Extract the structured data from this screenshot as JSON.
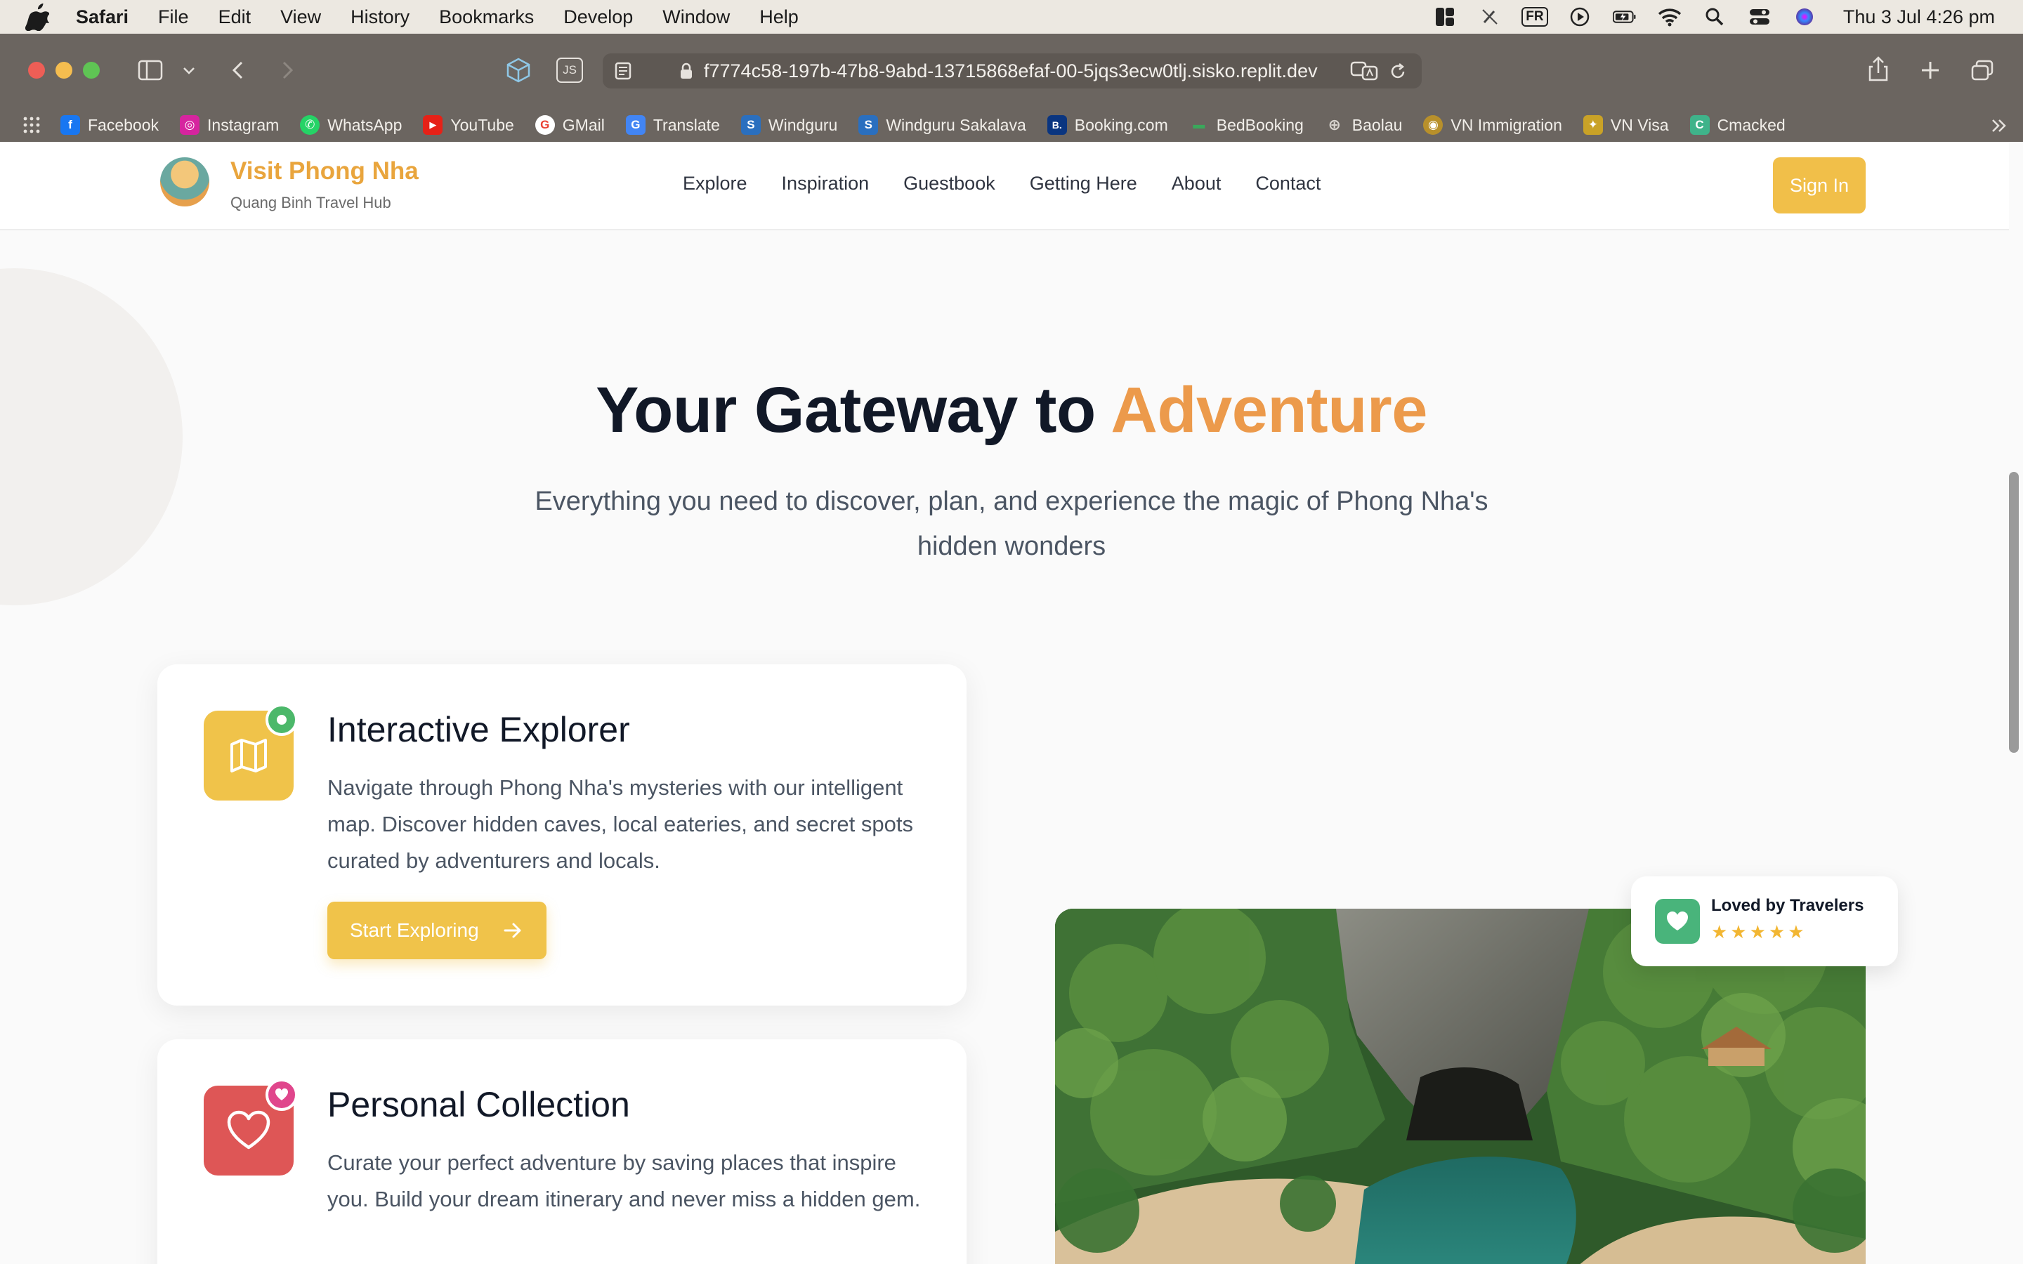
{
  "menubar": {
    "app": "Safari",
    "items": [
      "File",
      "Edit",
      "View",
      "History",
      "Bookmarks",
      "Develop",
      "Window",
      "Help"
    ],
    "input_lang": "FR",
    "clock": "Thu 3 Jul  4:26 pm"
  },
  "browser": {
    "url": "f7774c58-197b-47b8-9abd-13715868efaf-00-5jqs3ecw0tlj.sisko.replit.dev",
    "js_label": "JS",
    "bookmarks": [
      {
        "label": "Facebook",
        "color": "#1877f2",
        "glyph": "f"
      },
      {
        "label": "Instagram",
        "color": "#d6249f",
        "glyph": "◎"
      },
      {
        "label": "WhatsApp",
        "color": "#25d366",
        "glyph": "✆"
      },
      {
        "label": "YouTube",
        "color": "#e62117",
        "glyph": "▶"
      },
      {
        "label": "GMail",
        "color": "#ea4335",
        "glyph": "G"
      },
      {
        "label": "Translate",
        "color": "#4285f4",
        "glyph": "G"
      },
      {
        "label": "Windguru",
        "color": "#2a6fbf",
        "glyph": "S"
      },
      {
        "label": "Windguru Sakalava",
        "color": "#2a6fbf",
        "glyph": "S"
      },
      {
        "label": "Booking.com",
        "color": "#0a3580",
        "glyph": "B."
      },
      {
        "label": "BedBooking",
        "color": "#3aa85b",
        "glyph": "▬"
      },
      {
        "label": "Baolau",
        "color": "#777777",
        "glyph": "⊕"
      },
      {
        "label": "VN Immigration",
        "color": "#b8902b",
        "glyph": "◉"
      },
      {
        "label": "VN Visa",
        "color": "#c9a227",
        "glyph": "✦"
      },
      {
        "label": "Cmacked",
        "color": "#3fb38a",
        "glyph": "C"
      }
    ]
  },
  "site": {
    "brand": "Visit Phong Nha",
    "tagline": "Quang Binh Travel Hub",
    "nav": [
      "Explore",
      "Inspiration",
      "Guestbook",
      "Getting Here",
      "About",
      "Contact"
    ],
    "sign_in": "Sign In"
  },
  "hero": {
    "title_main": "Your Gateway to ",
    "title_accent": "Adventure",
    "subtitle": "Everything you need to discover, plan, and experience the magic of Phong Nha's hidden wonders"
  },
  "cards": [
    {
      "title": "Interactive Explorer",
      "text": "Navigate through Phong Nha's mysteries with our intelligent map. Discover hidden caves, local eateries, and secret spots curated by adventurers and locals.",
      "cta": "Start Exploring",
      "icon": "map-icon"
    },
    {
      "title": "Personal Collection",
      "text": "Curate your perfect adventure by saving places that inspire you. Build your dream itinerary and never miss a hidden gem.",
      "icon": "heart-icon"
    }
  ],
  "badge": {
    "label": "Loved by Travelers",
    "stars": "★★★★★",
    "rating": 5
  },
  "colors": {
    "brand": "#e9a53d",
    "accent": "#ec9a4b",
    "button": "#f0c34a"
  }
}
